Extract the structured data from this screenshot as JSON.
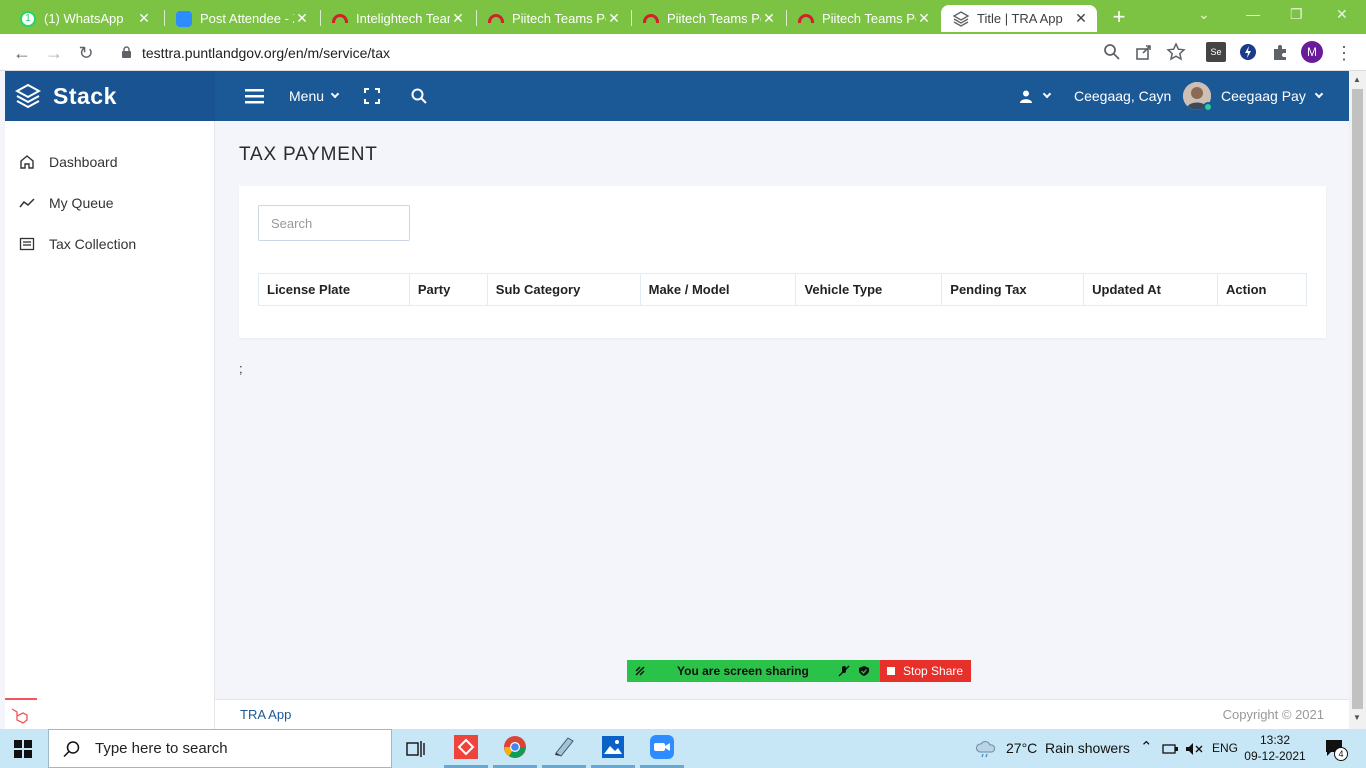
{
  "browser": {
    "tabs": [
      {
        "title": "(1) WhatsApp",
        "icon": "whatsapp-icon"
      },
      {
        "title": "Post Attendee - Z",
        "icon": "zoom-icon"
      },
      {
        "title": "Intelightech Team",
        "icon": "arc-logo-icon"
      },
      {
        "title": "Piitech Teams Po",
        "icon": "arc-logo-icon"
      },
      {
        "title": "Piitech Teams Po",
        "icon": "arc-logo-icon"
      },
      {
        "title": "Piitech Teams Po",
        "icon": "arc-logo-icon"
      },
      {
        "title": "Title | TRA App",
        "icon": "stack-logo-icon",
        "active": true
      }
    ],
    "url": "testtra.puntlandgov.org/en/m/service/tax",
    "profile_initial": "M",
    "accent_color": "#7cc243"
  },
  "app": {
    "brand": "Stack",
    "header": {
      "menu_label": "Menu",
      "user_short": "Ceegaag, Cayn",
      "user_name": "Ceegaag Pay",
      "color": "#1b5996"
    },
    "sidebar": {
      "items": [
        {
          "label": "Dashboard",
          "icon": "home-icon"
        },
        {
          "label": "My Queue",
          "icon": "trend-icon"
        },
        {
          "label": "Tax Collection",
          "icon": "list-icon"
        }
      ]
    },
    "page_title": "TAX PAYMENT",
    "search_placeholder": "Search",
    "table": {
      "columns": [
        "License Plate",
        "Party",
        "Sub Category",
        "Make / Model",
        "Vehicle Type",
        "Pending Tax",
        "Updated At",
        "Action"
      ],
      "rows": []
    },
    "stray_text": ";",
    "footer": {
      "left": "TRA App",
      "right": "Copyright © 2021"
    }
  },
  "screen_share": {
    "status": "You are screen sharing",
    "stop_label": "Stop Share"
  },
  "taskbar": {
    "search_placeholder": "Type here to search",
    "weather": "27°C  Rain showers",
    "language": "ENG",
    "time": "13:32",
    "date": "09-12-2021",
    "notifications": "4"
  }
}
